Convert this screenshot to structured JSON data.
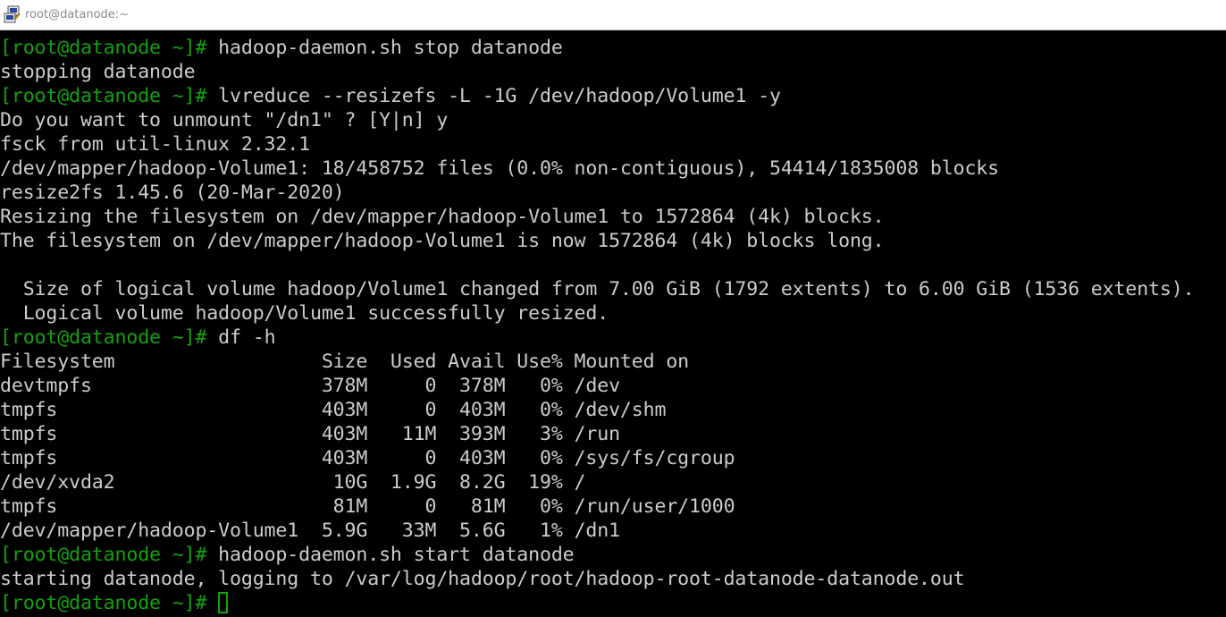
{
  "window": {
    "title": "root@datanode:~",
    "icon": "putty-icon"
  },
  "colors": {
    "background": "#000000",
    "text": "#cccccc",
    "prompt": "#13a10e",
    "cursor": "#13a10e"
  },
  "terminal": {
    "prompt": "[root@datanode ~]#",
    "lines": [
      {
        "type": "cmd",
        "text": " hadoop-daemon.sh stop datanode"
      },
      {
        "type": "out",
        "text": "stopping datanode"
      },
      {
        "type": "cmd",
        "text": " lvreduce --resizefs -L -1G /dev/hadoop/Volume1 -y"
      },
      {
        "type": "out",
        "text": "Do you want to unmount \"/dn1\" ? [Y|n] y"
      },
      {
        "type": "out",
        "text": "fsck from util-linux 2.32.1"
      },
      {
        "type": "out",
        "text": "/dev/mapper/hadoop-Volume1: 18/458752 files (0.0% non-contiguous), 54414/1835008 blocks"
      },
      {
        "type": "out",
        "text": "resize2fs 1.45.6 (20-Mar-2020)"
      },
      {
        "type": "out",
        "text": "Resizing the filesystem on /dev/mapper/hadoop-Volume1 to 1572864 (4k) blocks."
      },
      {
        "type": "out",
        "text": "The filesystem on /dev/mapper/hadoop-Volume1 is now 1572864 (4k) blocks long."
      },
      {
        "type": "out",
        "text": ""
      },
      {
        "type": "out",
        "text": "  Size of logical volume hadoop/Volume1 changed from 7.00 GiB (1792 extents) to 6.00 GiB (1536 extents)."
      },
      {
        "type": "out",
        "text": "  Logical volume hadoop/Volume1 successfully resized."
      },
      {
        "type": "cmd",
        "text": " df -h"
      },
      {
        "type": "out",
        "text": "Filesystem                  Size  Used Avail Use% Mounted on"
      },
      {
        "type": "out",
        "text": "devtmpfs                    378M     0  378M   0% /dev"
      },
      {
        "type": "out",
        "text": "tmpfs                       403M     0  403M   0% /dev/shm"
      },
      {
        "type": "out",
        "text": "tmpfs                       403M   11M  393M   3% /run"
      },
      {
        "type": "out",
        "text": "tmpfs                       403M     0  403M   0% /sys/fs/cgroup"
      },
      {
        "type": "out",
        "text": "/dev/xvda2                   10G  1.9G  8.2G  19% /"
      },
      {
        "type": "out",
        "text": "tmpfs                        81M     0   81M   0% /run/user/1000"
      },
      {
        "type": "out",
        "text": "/dev/mapper/hadoop-Volume1  5.9G   33M  5.6G   1% /dn1"
      },
      {
        "type": "cmd",
        "text": " hadoop-daemon.sh start datanode"
      },
      {
        "type": "out",
        "text": "starting datanode, logging to /var/log/hadoop/root/hadoop-root-datanode-datanode.out"
      },
      {
        "type": "cmd",
        "text": " ",
        "cursor": true
      }
    ]
  }
}
